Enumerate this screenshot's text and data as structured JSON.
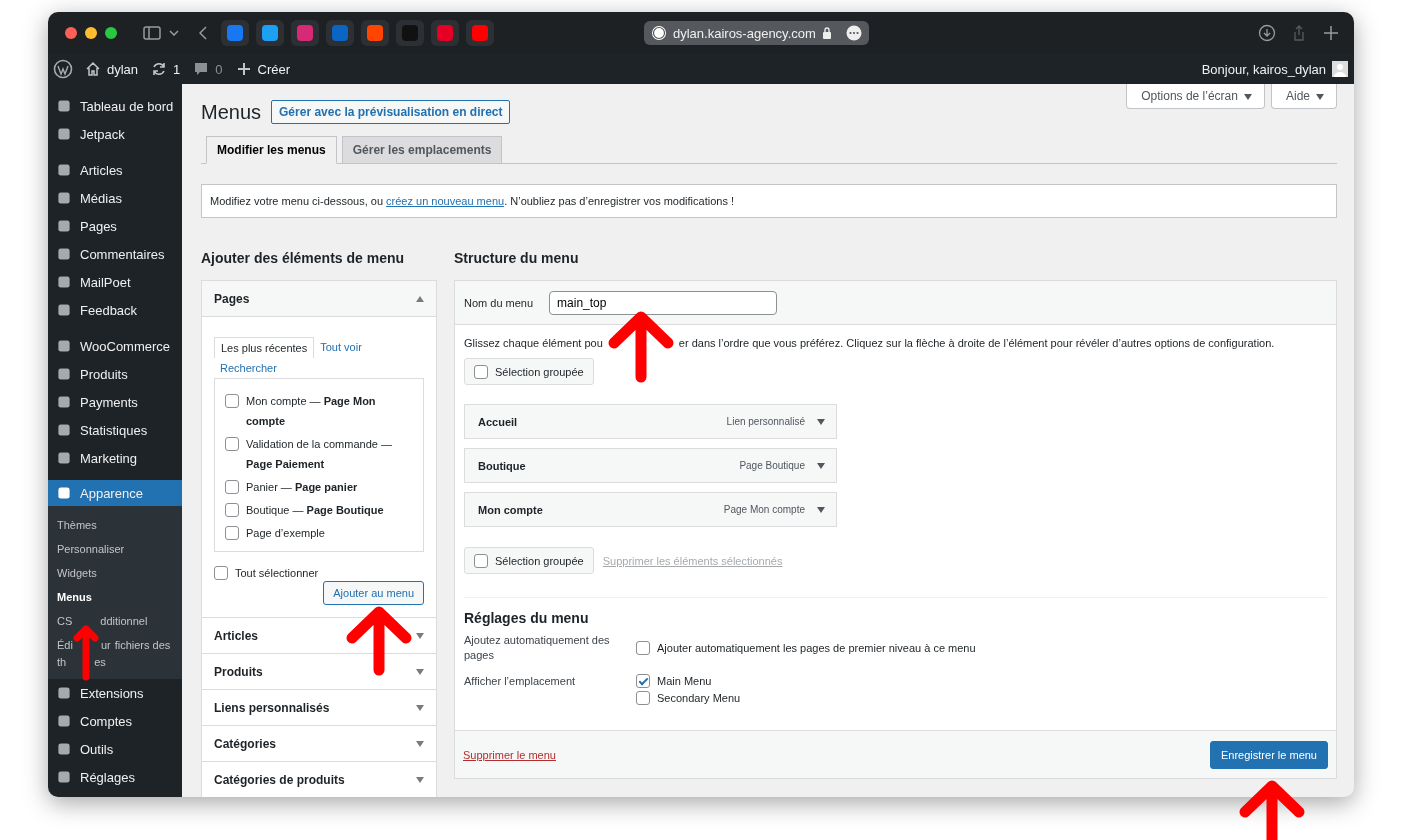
{
  "browser": {
    "url": "dylan.kairos-agency.com"
  },
  "admin_bar": {
    "site": "dylan",
    "updates": "1",
    "comments": "0",
    "new": "Créer",
    "greeting": "Bonjour, kairos_dylan"
  },
  "sidebar": {
    "groups": [
      {
        "items": [
          {
            "label": "Tableau de bord",
            "selected": false
          },
          {
            "label": "Jetpack",
            "selected": false
          }
        ]
      },
      {
        "items": [
          {
            "label": "Articles",
            "selected": false
          },
          {
            "label": "Médias",
            "selected": false
          },
          {
            "label": "Pages",
            "selected": false
          },
          {
            "label": "Commentaires",
            "selected": false
          },
          {
            "label": "MailPoet",
            "selected": false
          },
          {
            "label": "Feedback",
            "selected": false
          }
        ]
      },
      {
        "items": [
          {
            "label": "WooCommerce",
            "selected": false
          },
          {
            "label": "Produits",
            "selected": false
          },
          {
            "label": "Payments",
            "selected": false
          },
          {
            "label": "Statistiques",
            "selected": false
          },
          {
            "label": "Marketing",
            "selected": false
          }
        ]
      },
      {
        "items": [
          {
            "label": "Apparence",
            "selected": true,
            "children": [
              {
                "lines": [
                  [
                    "Thèmes"
                  ]
                ],
                "selected": false
              },
              {
                "lines": [
                  [
                    "Personnaliser"
                  ]
                ],
                "selected": false
              },
              {
                "lines": [
                  [
                    "Widgets"
                  ]
                ],
                "selected": false
              },
              {
                "lines": [
                  [
                    "Menus"
                  ]
                ],
                "selected": true
              },
              {
                "lines": [
                  [
                    "CS",
                    "dditionnel"
                  ]
                ],
                "selected": false
              },
              {
                "lines": [
                  [
                    "Édi",
                    "ur",
                    "fichiers des"
                  ],
                  [
                    "th",
                    "es"
                  ]
                ],
                "selected": false
              }
            ]
          },
          {
            "label": "Extensions",
            "selected": false
          },
          {
            "label": "Comptes",
            "selected": false
          },
          {
            "label": "Outils",
            "selected": false
          },
          {
            "label": "Réglages",
            "selected": false
          }
        ]
      }
    ]
  },
  "screen_options": [
    "Options de l’écran",
    "Aide"
  ],
  "page_title": "Menus",
  "live_preview_button": "Gérer avec la prévisualisation en direct",
  "tabs": [
    {
      "label": "Modifier les menus",
      "selected": true
    },
    {
      "label": "Gérer les emplacements",
      "selected": false
    }
  ],
  "notice": {
    "before": "Modifiez votre menu ci-dessous, ou ",
    "link": "créez un nouveau menu",
    "after": ". N’oubliez pas d’enregistrer vos modifications !"
  },
  "add_items": {
    "title": "Ajouter des éléments de menu",
    "sections": [
      {
        "title": "Pages",
        "expanded": true
      },
      {
        "title": "Articles",
        "expanded": false
      },
      {
        "title": "Produits",
        "expanded": false
      },
      {
        "title": "Liens personnalisés",
        "expanded": false
      },
      {
        "title": "Catégories",
        "expanded": false
      },
      {
        "title": "Catégories de produits",
        "expanded": false
      }
    ],
    "page_tabs": [
      {
        "label": "Les plus récentes",
        "selected": true
      },
      {
        "label": "Tout voir",
        "selected": false
      },
      {
        "label": "Rechercher",
        "selected": false
      }
    ],
    "pages": [
      {
        "label": "Mon compte — **Page Mon compte**",
        "checked": false
      },
      {
        "label": "Validation de la commande — **Page Paiement**",
        "checked": false
      },
      {
        "label": "Panier — **Page panier**",
        "checked": false
      },
      {
        "label": "Boutique — **Page Boutique**",
        "checked": false
      },
      {
        "label": "Page d’exemple",
        "checked": false
      }
    ],
    "select_all": {
      "label": "Tout sélectionner",
      "checked": false
    },
    "add_button": "Ajouter au menu"
  },
  "structure": {
    "title": "Structure du menu",
    "name_label": "Nom du menu",
    "name_value": "main_top",
    "instructions": [
      "Glissez chaque élément pou",
      "er dans l’ordre que vous préférez. Cliquez sur la flèche à droite de l’élément pour révéler d’autres options de configuration."
    ],
    "bulk_top": {
      "label": "Sélection groupée",
      "checked": false
    },
    "items": [
      {
        "title": "Accueil",
        "type": "Lien personnalisé"
      },
      {
        "title": "Boutique",
        "type": "Page Boutique"
      },
      {
        "title": "Mon compte",
        "type": "Page Mon compte"
      }
    ],
    "bulk_bottom": {
      "label": "Sélection groupée",
      "checked": false
    },
    "remove_selected": "Supprimer les éléments sélectionnés",
    "settings_title": "Réglages du menu",
    "auto_add": {
      "label": "Ajoutez automatiquement des pages",
      "option": "Ajouter automatiquement les pages de premier niveau à ce menu",
      "checked": false
    },
    "locations": {
      "label": "Afficher l’emplacement",
      "options": [
        {
          "label": "Main Menu",
          "checked": true
        },
        {
          "label": "Secondary Menu",
          "checked": false
        }
      ]
    },
    "delete_link": "Supprimer le menu",
    "save_button": "Enregistrer le menu"
  }
}
